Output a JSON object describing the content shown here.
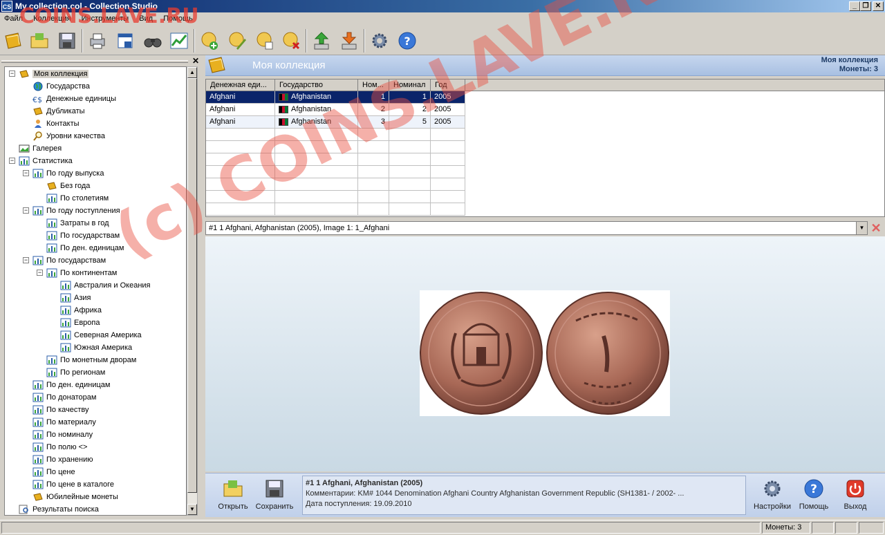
{
  "window": {
    "title": "My collection.col - Collection Studio",
    "app_icon": "CS",
    "minimize": "_",
    "maximize": "❐",
    "close": "✕"
  },
  "menu": [
    "Файл",
    "Коллекция",
    "Инструменты",
    "Вид",
    "Помощь"
  ],
  "toolbar": {
    "icons": [
      "open-collection-icon",
      "open-folder-icon",
      "save-icon",
      "print-icon",
      "print-preview-icon",
      "search-icon",
      "statistics-icon",
      "add-coin-icon",
      "edit-coin-icon",
      "copy-coin-icon",
      "delete-coin-icon",
      "export-icon",
      "import-icon",
      "settings-icon",
      "help-icon"
    ]
  },
  "tree": {
    "nodes": [
      {
        "label": "Моя коллекция",
        "level": 0,
        "icon": "book-icon",
        "expand": "−",
        "selected": true
      },
      {
        "label": "Государства",
        "level": 1,
        "icon": "globe-icon"
      },
      {
        "label": "Денежные единицы",
        "level": 1,
        "icon": "currency-icon"
      },
      {
        "label": "Дубликаты",
        "level": 1,
        "icon": "book-icon"
      },
      {
        "label": "Контакты",
        "level": 1,
        "icon": "person-icon"
      },
      {
        "label": "Уровни качества",
        "level": 1,
        "icon": "magnifier-icon"
      },
      {
        "label": "Галерея",
        "level": 0,
        "icon": "gallery-icon"
      },
      {
        "label": "Статистика",
        "level": 0,
        "icon": "chart-icon",
        "expand": "−"
      },
      {
        "label": "По году выпуска",
        "level": 1,
        "icon": "chart-icon",
        "expand": "−"
      },
      {
        "label": "Без года",
        "level": 2,
        "icon": "book-icon"
      },
      {
        "label": "По столетиям",
        "level": 2,
        "icon": "chart-icon"
      },
      {
        "label": "По году поступления",
        "level": 1,
        "icon": "chart-icon",
        "expand": "−"
      },
      {
        "label": "Затраты в год",
        "level": 2,
        "icon": "chart-icon"
      },
      {
        "label": "По государствам",
        "level": 2,
        "icon": "chart-icon"
      },
      {
        "label": "По ден. единицам",
        "level": 2,
        "icon": "chart-icon"
      },
      {
        "label": "По государствам",
        "level": 1,
        "icon": "chart-icon",
        "expand": "−"
      },
      {
        "label": "По континентам",
        "level": 2,
        "icon": "chart-icon",
        "expand": "−"
      },
      {
        "label": "Австралия и Океания",
        "level": 3,
        "icon": "chart-icon"
      },
      {
        "label": "Азия",
        "level": 3,
        "icon": "chart-icon"
      },
      {
        "label": "Африка",
        "level": 3,
        "icon": "chart-icon"
      },
      {
        "label": "Европа",
        "level": 3,
        "icon": "chart-icon"
      },
      {
        "label": "Северная Америка",
        "level": 3,
        "icon": "chart-icon"
      },
      {
        "label": "Южная Америка",
        "level": 3,
        "icon": "chart-icon"
      },
      {
        "label": "По монетным дворам",
        "level": 2,
        "icon": "chart-icon"
      },
      {
        "label": "По регионам",
        "level": 2,
        "icon": "chart-icon"
      },
      {
        "label": "По ден. единицам",
        "level": 1,
        "icon": "chart-icon"
      },
      {
        "label": "По донаторам",
        "level": 1,
        "icon": "chart-icon"
      },
      {
        "label": "По качеству",
        "level": 1,
        "icon": "chart-icon"
      },
      {
        "label": "По материалу",
        "level": 1,
        "icon": "chart-icon"
      },
      {
        "label": "По номиналу",
        "level": 1,
        "icon": "chart-icon"
      },
      {
        "label": "По полю <>",
        "level": 1,
        "icon": "chart-icon"
      },
      {
        "label": "По хранению",
        "level": 1,
        "icon": "chart-icon"
      },
      {
        "label": "По цене",
        "level": 1,
        "icon": "chart-icon"
      },
      {
        "label": "По цене в каталоге",
        "level": 1,
        "icon": "chart-icon"
      },
      {
        "label": "Юбилейные монеты",
        "level": 1,
        "icon": "book-icon"
      },
      {
        "label": "Результаты поиска",
        "level": 0,
        "icon": "search-results-icon"
      }
    ]
  },
  "collection_header": {
    "title": "Моя коллекция",
    "right_title": "Моя коллекция",
    "coin_count": "Монеты: 3"
  },
  "grid": {
    "columns": [
      "Денежная еди...",
      "Государство",
      "Ном...",
      "Номинал",
      "Год"
    ],
    "rows": [
      [
        "Afghani",
        "Afghanistan",
        "1",
        "1",
        "2005"
      ],
      [
        "Afghani",
        "Afghanistan",
        "2",
        "2",
        "2005"
      ],
      [
        "Afghani",
        "Afghanistan",
        "3",
        "5",
        "2005"
      ]
    ]
  },
  "image_panel": {
    "selector_value": "#1 1 Afghani, Afghanistan (2005), Image 1: 1_Afghani",
    "close": "✕"
  },
  "bottom": {
    "open_label": "Открыть",
    "save_label": "Сохранить",
    "info_line1": "#1 1 Afghani, Afghanistan (2005)",
    "info_line2": "Комментарии: KM# 1044 Denomination Afghani Country Afghanistan Government Republic (SH1381- / 2002- ...",
    "info_line3": "Дата поступления: 19.09.2010",
    "settings_label": "Настройки",
    "help_label": "Помощь",
    "exit_label": "Выход"
  },
  "status": {
    "coins": "Монеты: 3"
  },
  "watermark": {
    "top": "COINS.LAVE.RU",
    "diagonal": "(c) COINS.LAVE.RU"
  },
  "colors": {
    "accent": "#0a246a",
    "header_gradient": "#a8c0e2",
    "watermark": "#e85040"
  }
}
